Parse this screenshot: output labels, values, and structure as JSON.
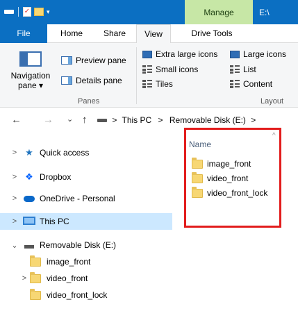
{
  "titlebar": {
    "manage_label": "Manage",
    "window_title": "E:\\",
    "icons": [
      "drive-icon",
      "checkmark-properties-icon",
      "new-folder-icon",
      "dropdown-icon"
    ]
  },
  "ribbon": {
    "tabs": [
      "File",
      "Home",
      "Share",
      "View",
      "Drive Tools"
    ],
    "active_tab": "View",
    "panes_group": {
      "navigation_pane": "Navigation",
      "navigation_pane_sub": "pane ▾",
      "preview_pane": "Preview pane",
      "details_pane": "Details pane",
      "group_label": "Panes"
    },
    "layout_group": {
      "extra_large_icons": "Extra large icons",
      "large_icons": "Large icons",
      "small_icons": "Small icons",
      "list": "List",
      "tiles": "Tiles",
      "content": "Content",
      "group_label": "Layout"
    }
  },
  "address": {
    "back": "←",
    "forward": "→",
    "recent": "⌄",
    "up": "↑",
    "crumbs": [
      "This PC",
      "Removable Disk (E:)"
    ],
    "separator": ">"
  },
  "nav_tree": {
    "items": [
      {
        "label": "Quick access",
        "chevron": ">",
        "icon": "star-icon"
      },
      {
        "label": "Dropbox",
        "chevron": ">",
        "icon": "dropbox-icon"
      },
      {
        "label": "OneDrive - Personal",
        "chevron": ">",
        "icon": "cloud-icon"
      },
      {
        "label": "This PC",
        "chevron": ">",
        "icon": "pc-icon",
        "selected": true
      },
      {
        "label": "Removable Disk (E:)",
        "chevron": "⌄",
        "icon": "drive-icon"
      },
      {
        "label": "image_front",
        "chevron": "",
        "icon": "folder-icon"
      },
      {
        "label": "video_front",
        "chevron": ">",
        "icon": "folder-icon"
      },
      {
        "label": "video_front_lock",
        "chevron": "",
        "icon": "folder-icon"
      }
    ]
  },
  "content": {
    "column_header": "Name",
    "sort_caret": "^",
    "files": [
      "image_front",
      "video_front",
      "video_front_lock"
    ]
  },
  "colors": {
    "titlebar": "#0b6fc2",
    "manage_tab": "#c7e7a6",
    "selected_nav": "#cce8ff",
    "highlight_box": "#e21c1c"
  }
}
